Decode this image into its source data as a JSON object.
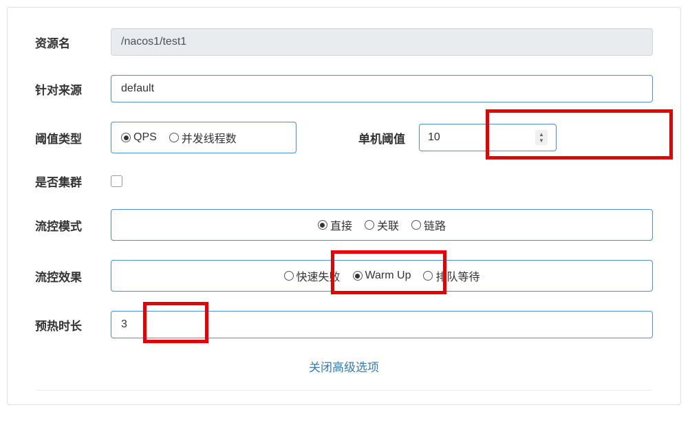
{
  "form": {
    "resource_name_label": "资源名",
    "resource_name_value": "/nacos1/test1",
    "source_label": "针对来源",
    "source_value": "default",
    "threshold_type_label": "阈值类型",
    "threshold_type_options": {
      "qps": "QPS",
      "threads": "并发线程数"
    },
    "single_threshold_label": "单机阈值",
    "single_threshold_value": "10",
    "cluster_label": "是否集群",
    "flow_mode_label": "流控模式",
    "flow_mode_options": {
      "direct": "直接",
      "relate": "关联",
      "chain": "链路"
    },
    "flow_effect_label": "流控效果",
    "flow_effect_options": {
      "fail_fast": "快速失败",
      "warm_up": "Warm Up",
      "queue": "排队等待"
    },
    "warmup_duration_label": "预热时长",
    "warmup_duration_value": "3",
    "close_advanced": "关闭高级选项"
  }
}
